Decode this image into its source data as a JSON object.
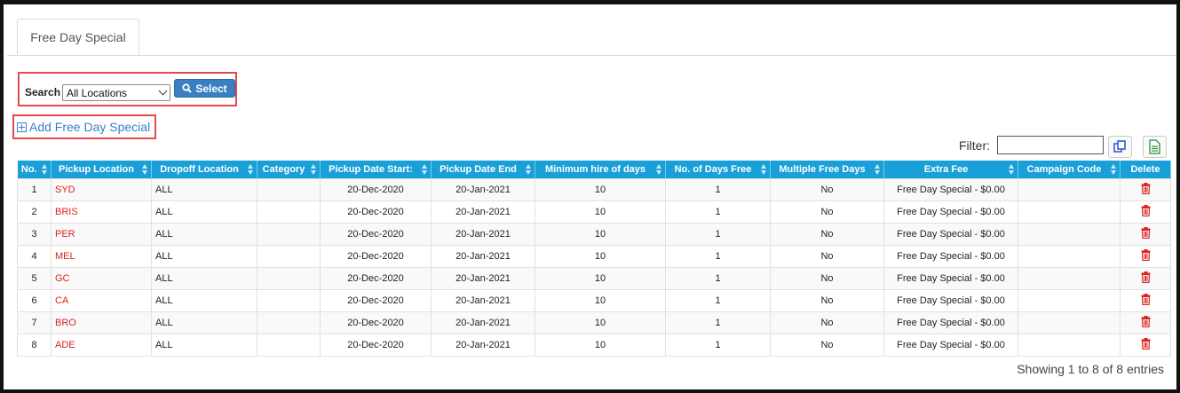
{
  "tab": {
    "label": "Free Day Special"
  },
  "search": {
    "label": "Search",
    "selected": "All Locations",
    "button": "Select"
  },
  "add_link": "Add Free Day Special",
  "filter": {
    "label": "Filter:",
    "value": ""
  },
  "colors": {
    "header": "#1aa0d8",
    "accent": "#3a7fc2",
    "location": "#d9231e",
    "highlight": "#e5484d"
  },
  "table": {
    "headers": [
      "No.",
      "Pickup Location",
      "Dropoff Location",
      "Category",
      "Pickup Date Start:",
      "Pickup Date End",
      "Minimum hire of days",
      "No. of Days Free",
      "Multiple Free Days",
      "Extra Fee",
      "Campaign Code",
      "Delete"
    ],
    "rows": [
      [
        "1",
        "SYD",
        "ALL",
        "",
        "20-Dec-2020",
        "20-Jan-2021",
        "10",
        "1",
        "No",
        "Free Day Special - $0.00",
        ""
      ],
      [
        "2",
        "BRIS",
        "ALL",
        "",
        "20-Dec-2020",
        "20-Jan-2021",
        "10",
        "1",
        "No",
        "Free Day Special - $0.00",
        ""
      ],
      [
        "3",
        "PER",
        "ALL",
        "",
        "20-Dec-2020",
        "20-Jan-2021",
        "10",
        "1",
        "No",
        "Free Day Special - $0.00",
        ""
      ],
      [
        "4",
        "MEL",
        "ALL",
        "",
        "20-Dec-2020",
        "20-Jan-2021",
        "10",
        "1",
        "No",
        "Free Day Special - $0.00",
        ""
      ],
      [
        "5",
        "GC",
        "ALL",
        "",
        "20-Dec-2020",
        "20-Jan-2021",
        "10",
        "1",
        "No",
        "Free Day Special - $0.00",
        ""
      ],
      [
        "6",
        "CA",
        "ALL",
        "",
        "20-Dec-2020",
        "20-Jan-2021",
        "10",
        "1",
        "No",
        "Free Day Special - $0.00",
        ""
      ],
      [
        "7",
        "BRO",
        "ALL",
        "",
        "20-Dec-2020",
        "20-Jan-2021",
        "10",
        "1",
        "No",
        "Free Day Special - $0.00",
        ""
      ],
      [
        "8",
        "ADE",
        "ALL",
        "",
        "20-Dec-2020",
        "20-Jan-2021",
        "10",
        "1",
        "No",
        "Free Day Special - $0.00",
        ""
      ]
    ]
  },
  "footer": {
    "showing": "Showing 1 to 8 of 8 entries"
  }
}
